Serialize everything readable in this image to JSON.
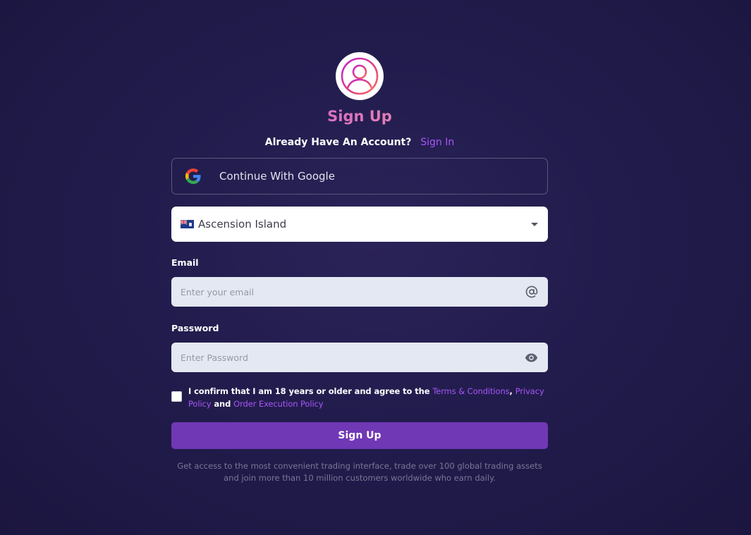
{
  "header": {
    "avatar_icon": "user-circle-icon",
    "title": "Sign Up",
    "account_question": "Already Have An Account?",
    "sign_in_label": "Sign In"
  },
  "google": {
    "icon": "google-icon",
    "label": "Continue With Google"
  },
  "country": {
    "flag_icon": "ascension-island-flag-icon",
    "selected": "Ascension Island",
    "caret_icon": "caret-down-icon"
  },
  "email": {
    "label": "Email",
    "placeholder": "Enter your email",
    "value": "",
    "icon": "at-sign-icon"
  },
  "password": {
    "label": "Password",
    "placeholder": "Enter Password",
    "value": "",
    "icon": "eye-icon"
  },
  "consent": {
    "checked": false,
    "text_part1": "I confirm that I am 18 years or older and agree to the ",
    "terms_link": "Terms & Conditions",
    "comma": ", ",
    "privacy_link": "Privacy Policy",
    "and": " and ",
    "execution_link": "Order Execution Policy"
  },
  "submit_label": "Sign Up",
  "footer_note": "Get access to the most convenient trading interface, trade over 100 global trading assets and join more than 10 million customers worldwide who earn daily.",
  "colors": {
    "background": "#221c4d",
    "accent": "#a855f7",
    "button": "#7038b5",
    "input_bg": "#e4e8f2"
  }
}
